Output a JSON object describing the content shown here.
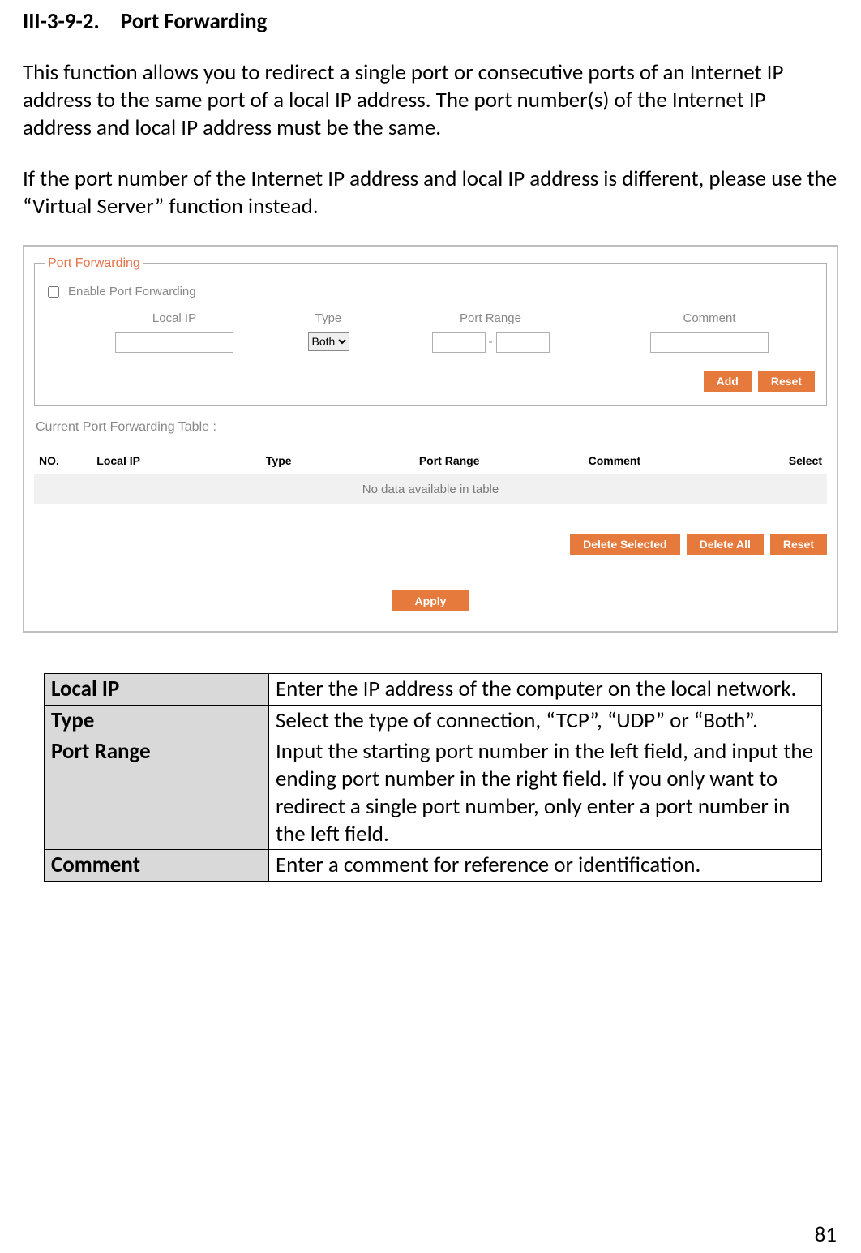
{
  "section": {
    "number": "III-3-9-2.",
    "title": "Port Forwarding"
  },
  "para1": "This function allows you to redirect a single port or consecutive ports of an Internet IP address to the same port of a local IP address. The port number(s) of the Internet IP address and local IP address must be the same.",
  "para2": "If the port number of the Internet IP address and local IP address is different, please use the “Virtual Server” function instead.",
  "panel": {
    "legend": "Port Forwarding",
    "enable_label": "Enable Port Forwarding",
    "form_headers": {
      "local_ip": "Local IP",
      "type": "Type",
      "port_range": "Port Range",
      "comment": "Comment"
    },
    "type_value": "Both",
    "range_sep": "-",
    "buttons": {
      "add": "Add",
      "reset": "Reset",
      "delete_selected": "Delete Selected",
      "delete_all": "Delete All",
      "reset2": "Reset",
      "apply": "Apply"
    },
    "current_title": "Current Port Forwarding Table  :",
    "table_headers": {
      "no": "NO.",
      "local_ip": "Local IP",
      "type": "Type",
      "port_range": "Port Range",
      "comment": "Comment",
      "select": "Select"
    },
    "empty_text": "No data available in table"
  },
  "desc": {
    "rows": [
      {
        "term": "Local IP",
        "text": "Enter the IP address of the computer on the local network."
      },
      {
        "term": "Type",
        "text": "Select the type of connection, “TCP”, “UDP” or “Both”."
      },
      {
        "term": "Port Range",
        "text": "Input the starting port number in the left field, and input the ending port number in the right field. If you only want to redirect a single port number, only enter a port number in the left field."
      },
      {
        "term": "Comment",
        "text": "Enter a comment for reference or identification."
      }
    ]
  },
  "page_number": "81"
}
